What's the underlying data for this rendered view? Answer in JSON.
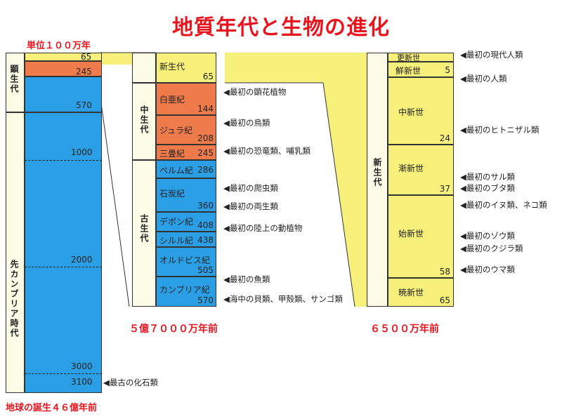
{
  "title": "地質年代と生物の進化",
  "unit_label": "単位１００万年",
  "origin_label": "地球の誕生４６億年前",
  "col1": {
    "eon_phanerozoic": "顕生代",
    "eon_precambrian": "先カンブリア時代",
    "ticks": [
      "65",
      "245",
      "570",
      "1000",
      "2000",
      "3000",
      "3100"
    ],
    "note_3100": "◀最古の化石類"
  },
  "col2": {
    "era_mesozoic": "中生代",
    "era_paleozoic": "古生代",
    "cenozoic": {
      "name": "新生代",
      "value": "65"
    },
    "periods": [
      {
        "name": "白亜紀",
        "value": "144"
      },
      {
        "name": "ジュラ紀",
        "value": "208"
      },
      {
        "name": "三畳紀",
        "value": "245"
      },
      {
        "name": "ペルム紀",
        "value": "286"
      },
      {
        "name": "石炭紀",
        "value": "360"
      },
      {
        "name": "デボン紀",
        "value": "408"
      },
      {
        "name": "シルル紀",
        "value": "438"
      },
      {
        "name": "オルドビス紀",
        "value": "505"
      },
      {
        "name": "カンブリア紀",
        "value": "570"
      }
    ],
    "caption": "５億７０００万年前",
    "notes": [
      "◀最初の顕花植物",
      "◀最初の鳥類",
      "◀最初の恐竜類、哺乳類",
      "◀最初の爬虫類",
      "◀最初の両生類",
      "◀最初の陸上の動植物",
      "◀最初の魚類",
      "◀海中の貝類、甲殻類、サンゴ類"
    ]
  },
  "col3": {
    "era": "新生代",
    "epochs": [
      {
        "name": "更新世",
        "value": ""
      },
      {
        "name": "鮮新世",
        "value": "5"
      },
      {
        "name": "中新世",
        "value": "24"
      },
      {
        "name": "漸新世",
        "value": "37"
      },
      {
        "name": "始新世",
        "value": "58"
      },
      {
        "name": "暁新世",
        "value": "65"
      }
    ],
    "caption": "６５００万年前",
    "notes": [
      "◀最初の現代人類",
      "◀最初の人類",
      "◀最初のヒトニザル類",
      "◀最初のサル類",
      "◀最初のブタ類",
      "◀最初のイヌ類、ネコ類",
      "◀最初のゾウ類",
      "◀最初のクジラ類",
      "◀最初のウマ類"
    ]
  },
  "colors": {
    "yellow": "#f7f07a",
    "orange": "#ef7a4a",
    "blue": "#2b9fe6",
    "pale": "#fbfbe6",
    "red": "#e8141e"
  }
}
